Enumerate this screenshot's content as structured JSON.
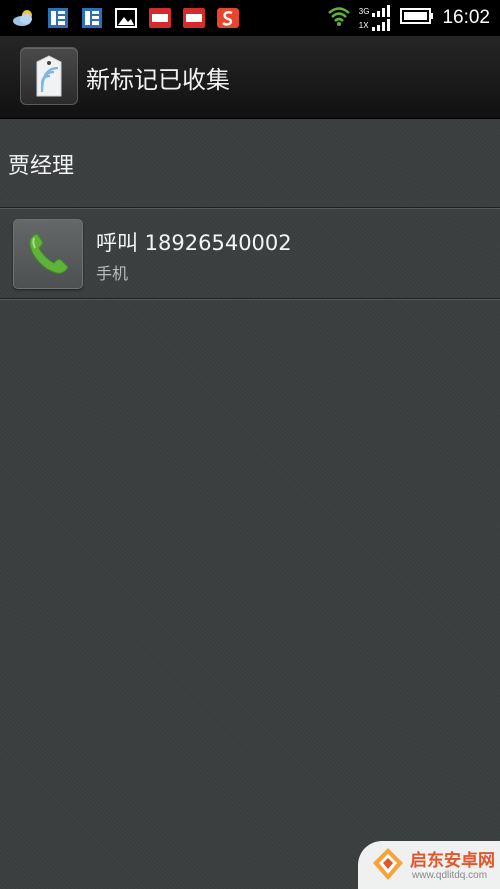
{
  "status_bar": {
    "time": "16:02",
    "network_top": "3G",
    "network_bottom": "1X",
    "notification_icons": [
      "weather-icon",
      "news-icon",
      "news-icon",
      "gallery-icon",
      "toutiao-icon",
      "toutiao-icon",
      "sohu-icon"
    ]
  },
  "header": {
    "title": "新标记已收集"
  },
  "contact": {
    "name": "贾经理"
  },
  "call_item": {
    "label": "呼叫 18926540002",
    "type": "手机"
  },
  "watermark": {
    "title": "启东安卓网",
    "url": "www.qdlitdq.com"
  },
  "colors": {
    "background": "#3b3e3f",
    "titlebar": "#1a1a1a",
    "phone_green": "#5fb33a",
    "watermark_orange": "#e2562b"
  }
}
